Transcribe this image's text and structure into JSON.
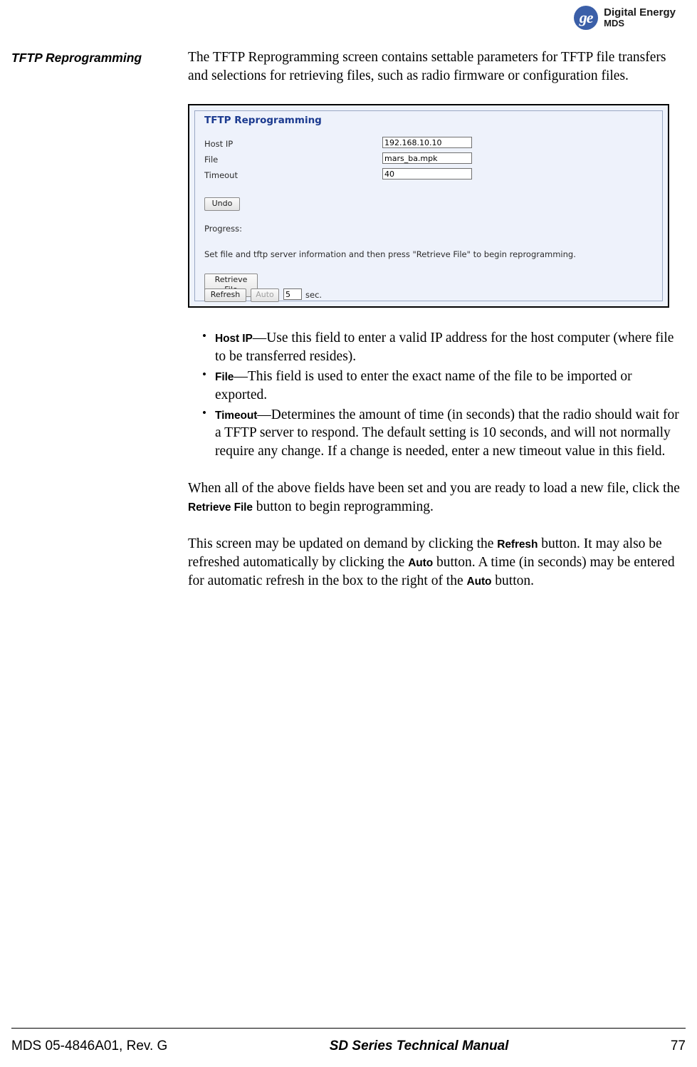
{
  "header": {
    "ge_monogram": "ge-logo-icon",
    "brand_line1": "Digital Energy",
    "brand_line2": "MDS"
  },
  "section": {
    "title": "TFTP Reprogramming"
  },
  "intro": {
    "paragraph": "The TFTP Reprogramming screen contains settable parameters for TFTP file transfers and selections for retrieving files, such as radio firmware or configuration files."
  },
  "figure": {
    "title": "TFTP Reprogramming",
    "fields": [
      {
        "label": "Host IP",
        "value": "192.168.10.10"
      },
      {
        "label": "File",
        "value": "mars_ba.mpk"
      },
      {
        "label": "Timeout",
        "value": "40"
      }
    ],
    "undo_button": "Undo",
    "progress_label": "Progress:",
    "status_text": "Set file and tftp server information and then press \"Retrieve File\" to begin reprogramming.",
    "retrieve_button": "Retrieve File",
    "refresh_button": "Refresh",
    "auto_button": "Auto",
    "auto_seconds": "5",
    "sec_label": "sec."
  },
  "bullets": [
    {
      "term": "Host IP",
      "text": "—Use this field to enter a valid IP address for the host computer (where file to be transferred resides)."
    },
    {
      "term": "File",
      "text": "—This field is used to enter the exact name of the file to be imported or exported."
    },
    {
      "term": "Timeout",
      "text": "—Determines the amount of time (in seconds) that the radio should wait for a TFTP server to respond. The default setting is 10 seconds, and will not normally require any change. If a change is needed, enter a new timeout value in this field."
    }
  ],
  "para_retrieve": {
    "before": "When all of the above fields have been set and you are ready to load a new file, click the ",
    "term": "Retrieve File",
    "after": " button to begin reprogramming."
  },
  "para_refresh": {
    "p1": "This screen may be updated on demand by clicking the ",
    "t1": "Refresh",
    "p2": " button. It may also be refreshed automatically by clicking the ",
    "t2": "Auto",
    "p3": " button. A time (in seconds) may be entered for automatic refresh in the box to the right of the ",
    "t3": "Auto",
    "p4": " button."
  },
  "footer": {
    "left": "MDS 05-4846A01, Rev. G",
    "center": "SD Series Technical Manual",
    "right": "77"
  }
}
